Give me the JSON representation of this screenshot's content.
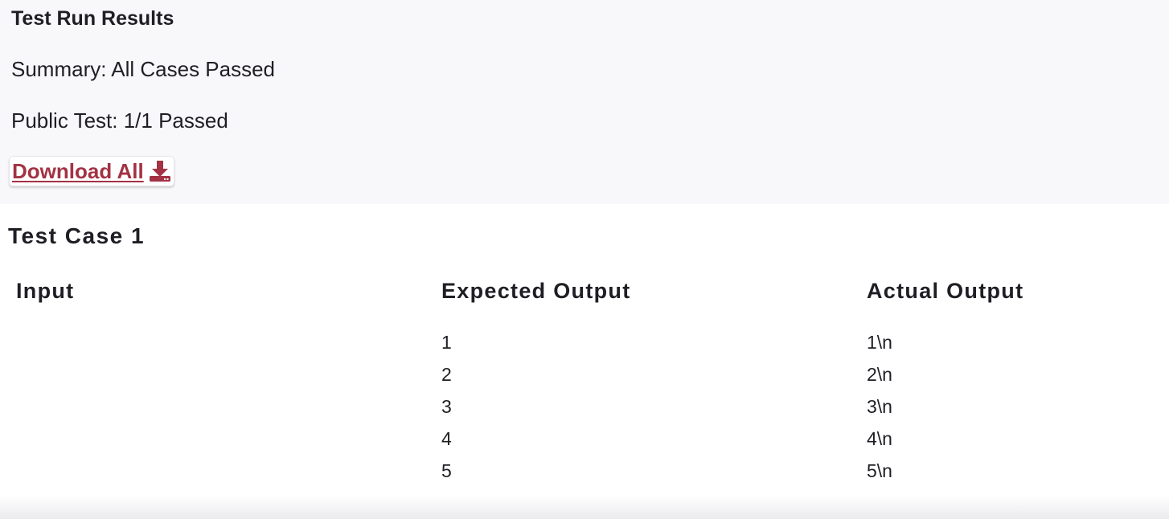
{
  "results": {
    "title": "Test Run Results",
    "summary": "Summary: All Cases Passed",
    "public_test": "Public Test: 1/1 Passed",
    "download_label": "Download All",
    "download_icon": "download-icon",
    "accent_color": "#a33244"
  },
  "test_case": {
    "title": "Test Case 1",
    "columns": [
      "Input",
      "Expected Output",
      "Actual Output"
    ],
    "input_lines": [],
    "expected_output": [
      "1",
      "2",
      "3",
      "4",
      "5"
    ],
    "actual_output": [
      "1\\n",
      "2\\n",
      "3\\n",
      "4\\n",
      "5\\n"
    ]
  }
}
